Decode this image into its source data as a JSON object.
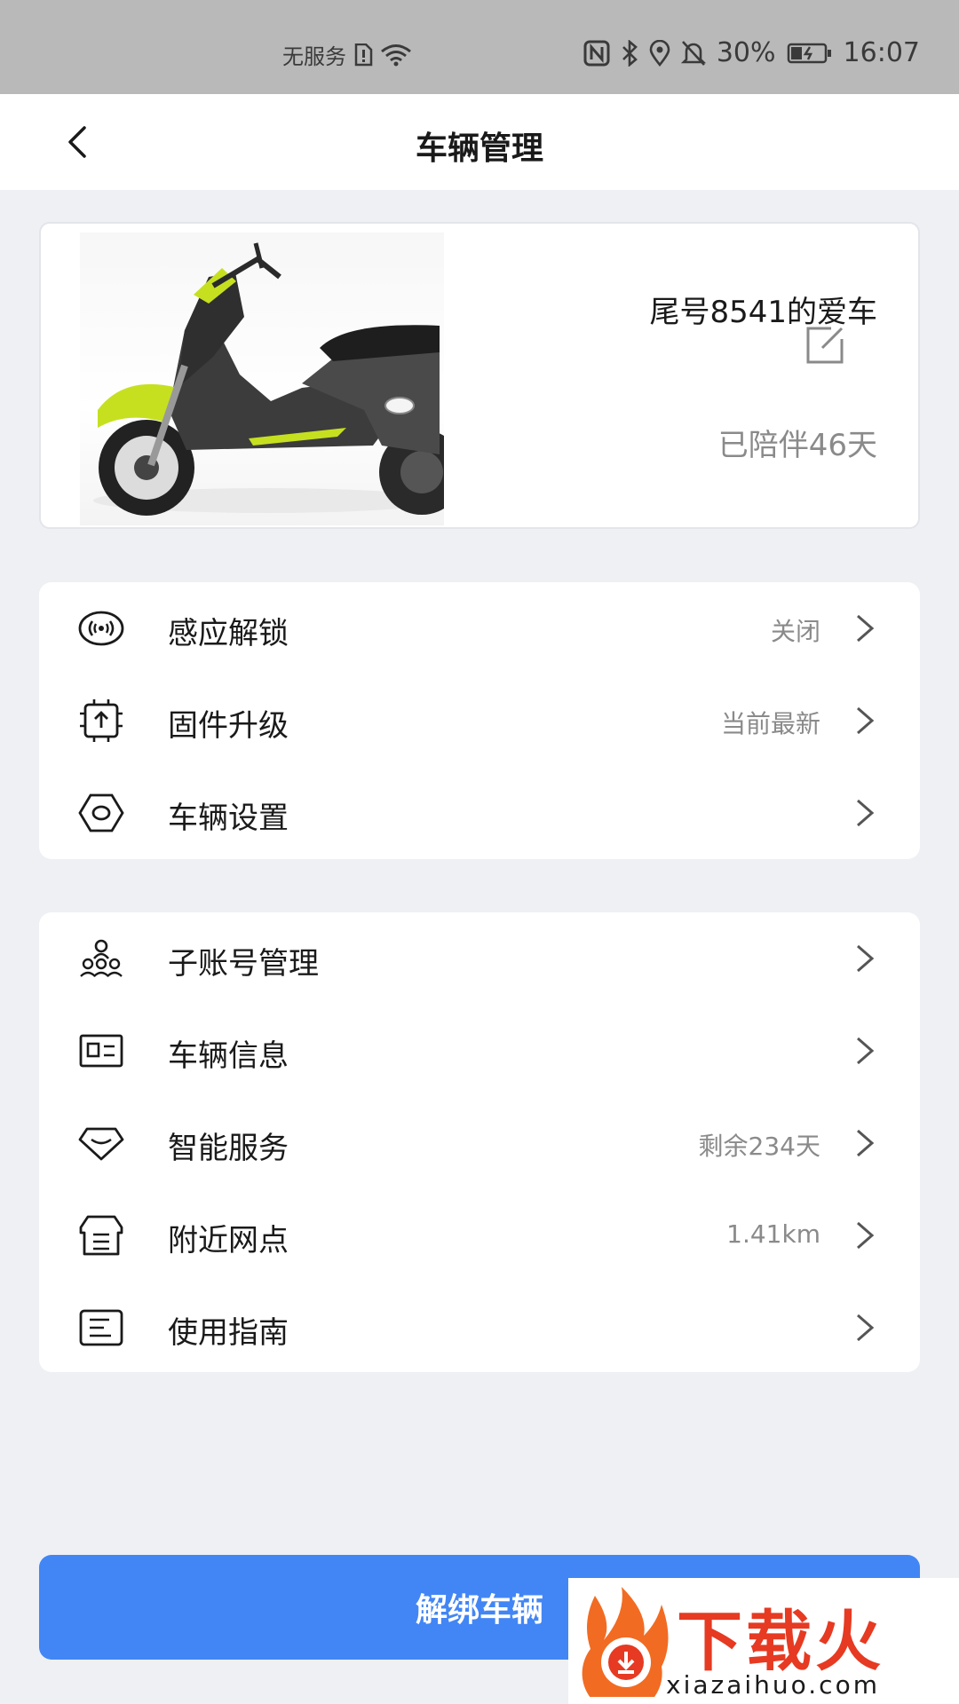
{
  "status_bar": {
    "carrier": "无服务",
    "battery": "30%",
    "time": "16:07"
  },
  "header": {
    "title": "车辆管理",
    "back_icon": "chevron-left-icon"
  },
  "vehicle": {
    "name": "尾号8541的爱车",
    "companion": "已陪伴46天",
    "accent": "#c6e020"
  },
  "group1": {
    "items": [
      {
        "label": "感应解锁",
        "value": "关闭",
        "icon": "proximity-unlock-icon"
      },
      {
        "label": "固件升级",
        "value": "当前最新",
        "icon": "firmware-upgrade-icon"
      },
      {
        "label": "车辆设置",
        "value": "",
        "icon": "hex-nut-settings-icon"
      }
    ]
  },
  "group2": {
    "items": [
      {
        "label": "子账号管理",
        "value": "",
        "icon": "sub-account-icon"
      },
      {
        "label": "车辆信息",
        "value": "",
        "icon": "id-card-icon"
      },
      {
        "label": "智能服务",
        "value": "剩余234天",
        "icon": "diamond-icon"
      },
      {
        "label": "附近网点",
        "value": "1.41km",
        "icon": "store-icon"
      },
      {
        "label": "使用指南",
        "value": "",
        "icon": "guide-icon"
      }
    ]
  },
  "actions": {
    "unbind_label": "解绑车辆"
  },
  "watermark": {
    "brand": "下载火",
    "url": "xiazaihuo.com"
  },
  "colors": {
    "primary": "#4286f5",
    "background": "#eef0f4",
    "muted_text": "#8a8a8a",
    "watermark": "#e63a22"
  }
}
